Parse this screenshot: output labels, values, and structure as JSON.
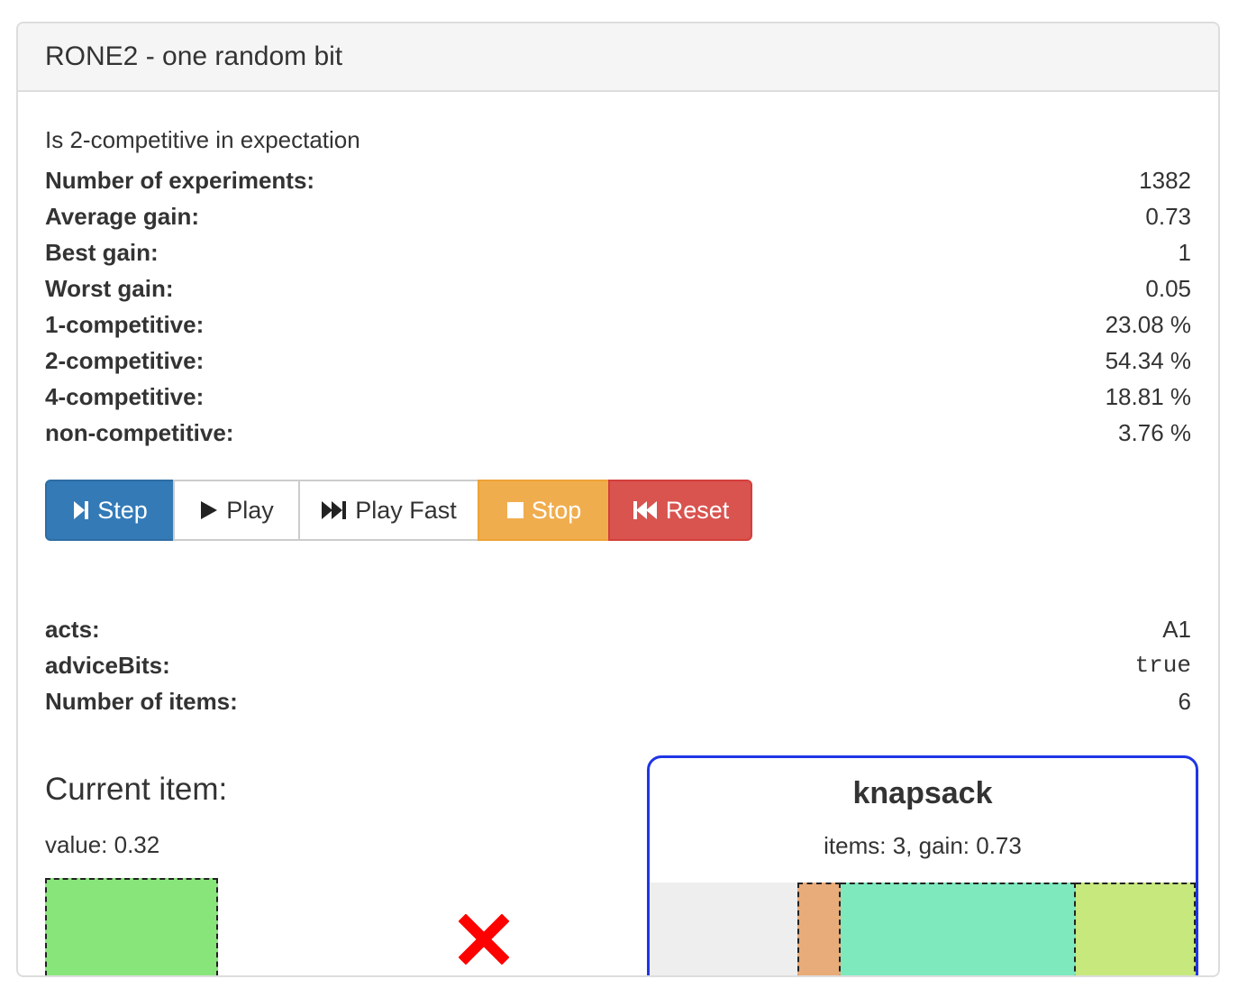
{
  "panel": {
    "title": "RONE2 - one random bit"
  },
  "description": "Is 2-competitive in expectation",
  "stats": [
    {
      "label": "Number of experiments:",
      "value": "1382"
    },
    {
      "label": "Average gain:",
      "value": "0.73"
    },
    {
      "label": "Best gain:",
      "value": "1"
    },
    {
      "label": "Worst gain:",
      "value": "0.05"
    },
    {
      "label": "1-competitive:",
      "value": "23.08 %"
    },
    {
      "label": "2-competitive:",
      "value": "54.34 %"
    },
    {
      "label": "4-competitive:",
      "value": "18.81 %"
    },
    {
      "label": "non-competitive:",
      "value": "3.76 %"
    }
  ],
  "controls": {
    "step": {
      "label": "Step",
      "icon": "step-forward-icon"
    },
    "play": {
      "label": "Play",
      "icon": "play-icon"
    },
    "play_fast": {
      "label": "Play Fast",
      "icon": "fast-forward-icon"
    },
    "stop": {
      "label": "Stop",
      "icon": "stop-icon"
    },
    "reset": {
      "label": "Reset",
      "icon": "fast-backward-icon"
    }
  },
  "info": [
    {
      "label": "acts:",
      "value": "A1"
    },
    {
      "label": "adviceBits:",
      "value": "true"
    },
    {
      "label": "Number of items:",
      "value": "6"
    }
  ],
  "current_item": {
    "title": "Current item:",
    "value_text": "value: 0.32",
    "color": "#87e57a",
    "status_icon": "reject-x-icon",
    "status_color": "#ff0000"
  },
  "knapsack": {
    "title": "knapsack",
    "summary": "items: 3, gain: 0.73",
    "border_color": "#1f35e6",
    "empty_fraction": 0.27,
    "items": [
      {
        "fraction": 0.08,
        "color": "#e8ab7a"
      },
      {
        "fraction": 0.43,
        "color": "#7de9bd"
      },
      {
        "fraction": 0.22,
        "color": "#c6e87c"
      }
    ]
  }
}
